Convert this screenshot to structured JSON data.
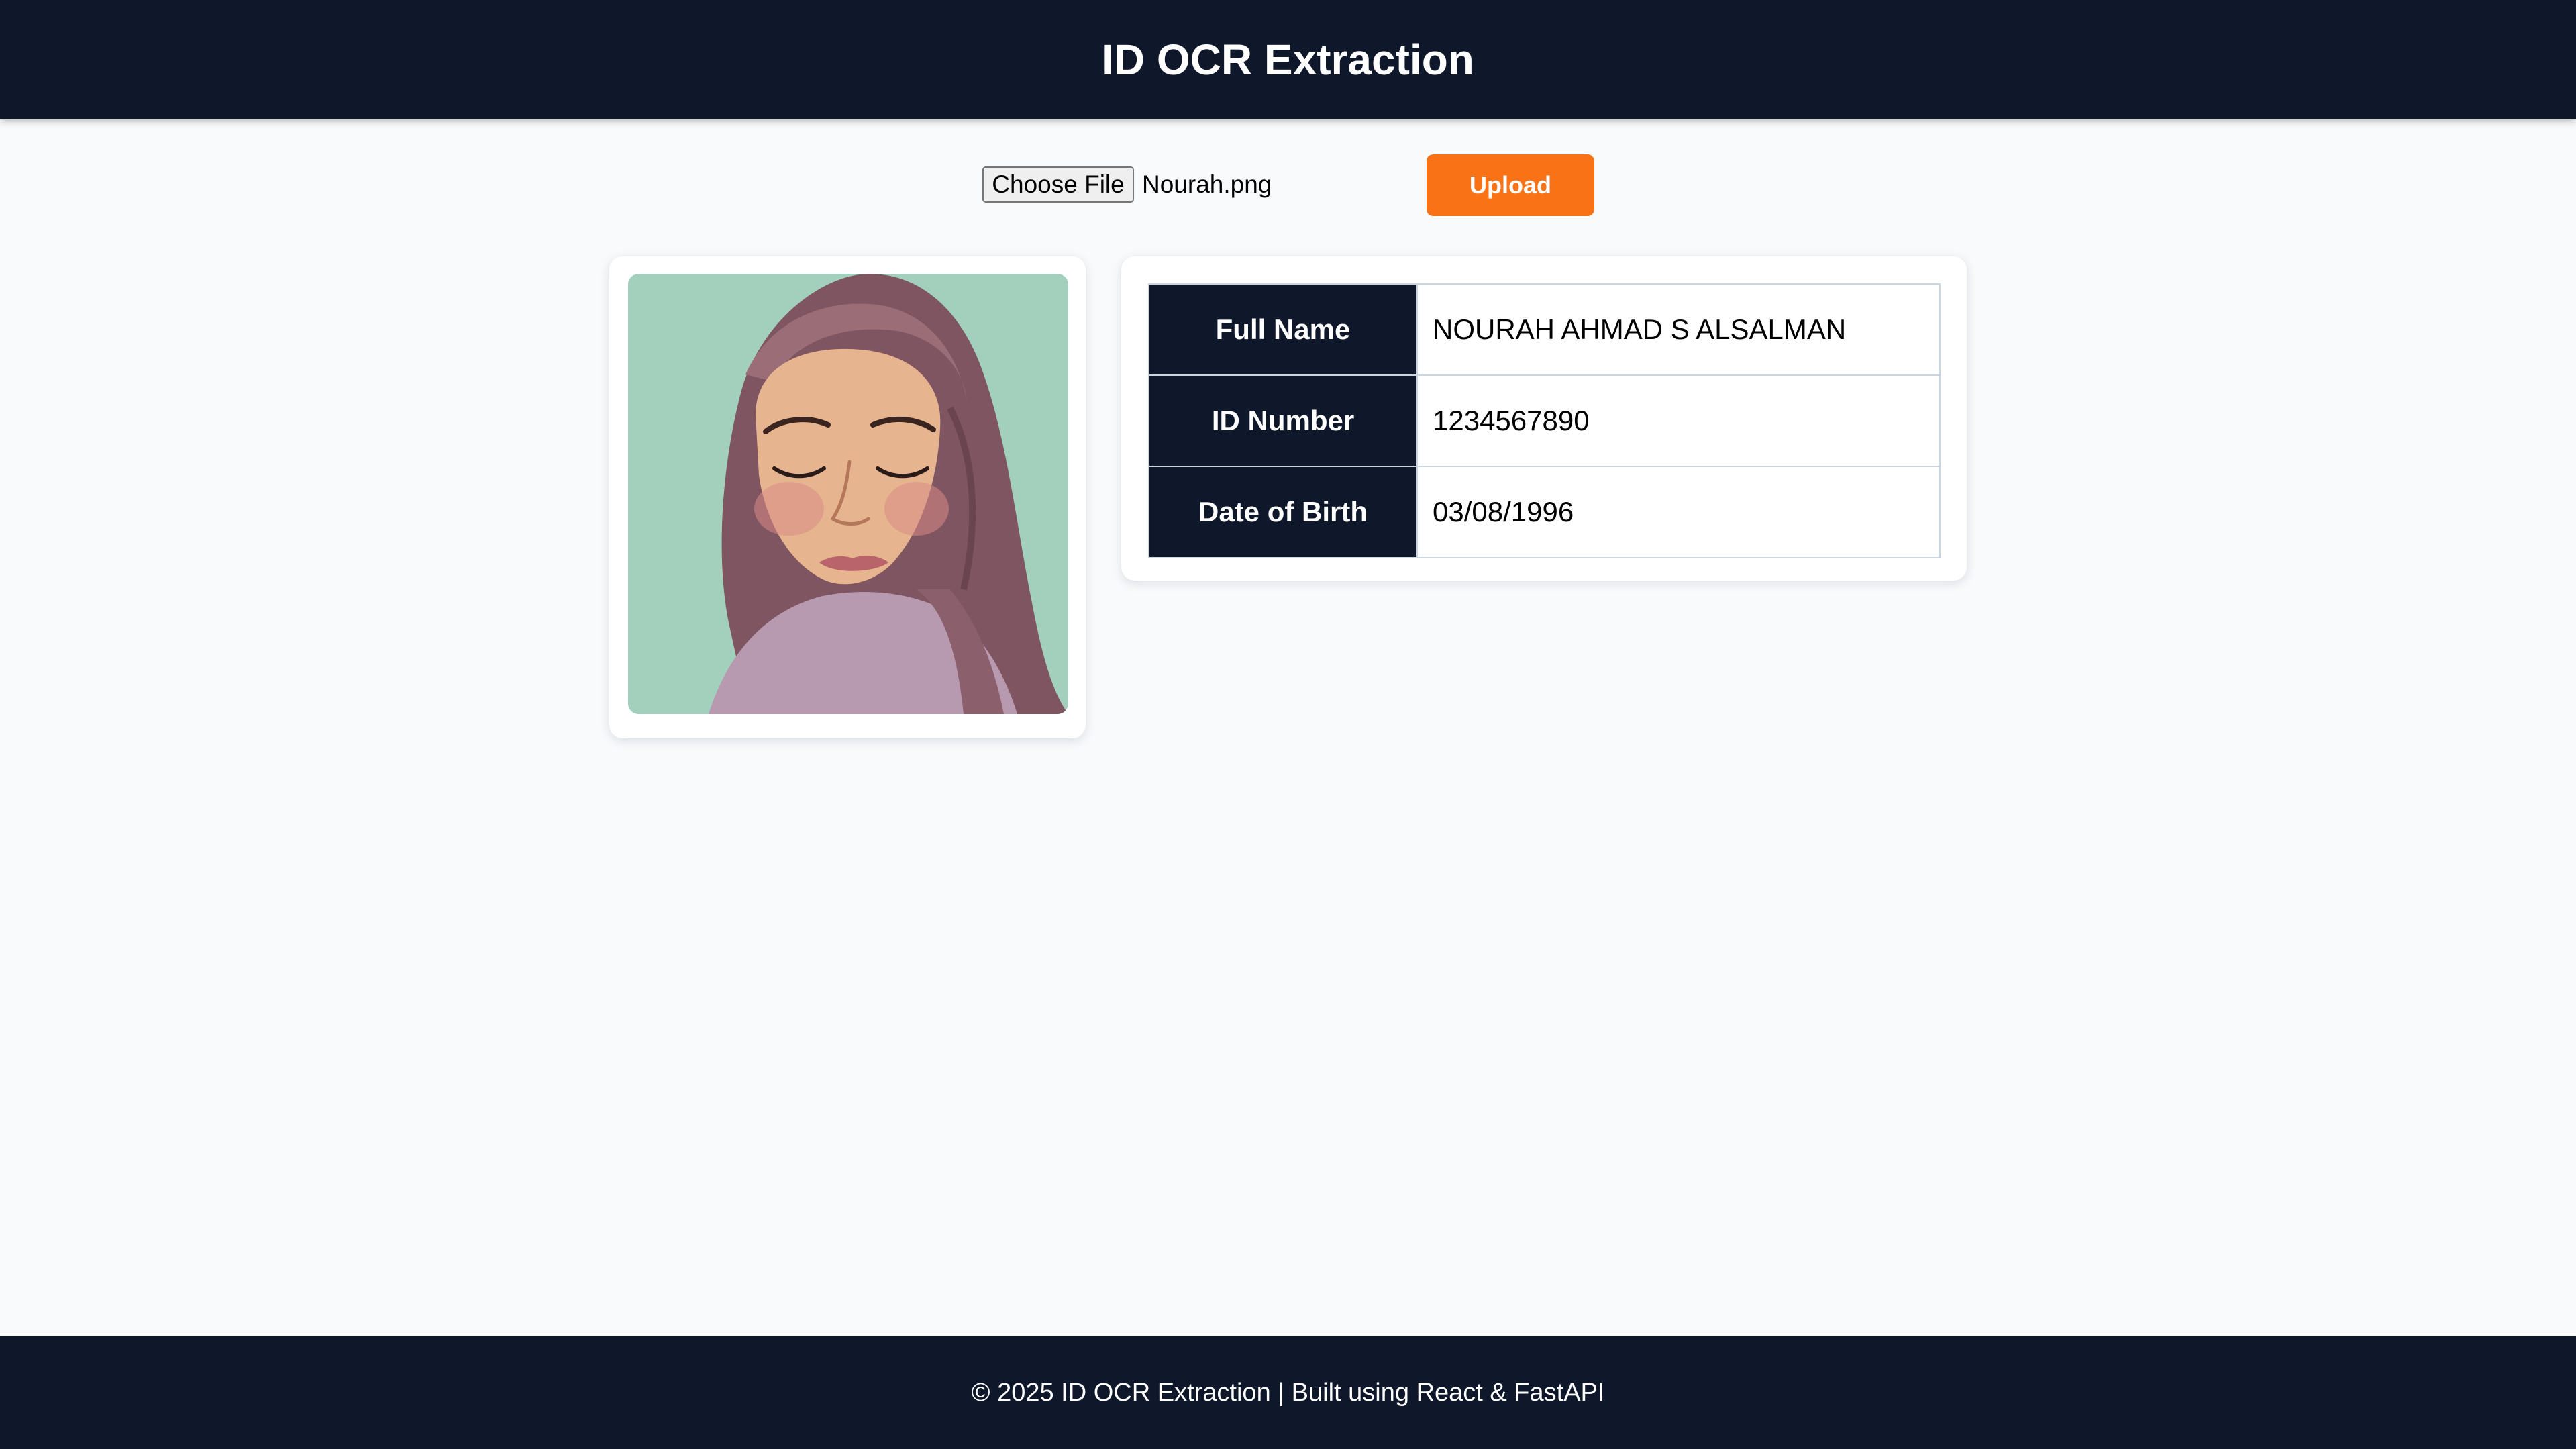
{
  "header": {
    "title": "ID OCR Extraction"
  },
  "upload": {
    "choose_file_label": "Choose File",
    "file_name": "Nourah.png",
    "upload_label": "Upload"
  },
  "photo": {
    "subject": "watercolor portrait of a woman in a mauve hijab",
    "background_color": "#a2d0bc"
  },
  "fields": {
    "full_name": {
      "label": "Full Name",
      "value": "NOURAH AHMAD S ALSALMAN"
    },
    "id_number": {
      "label": "ID Number",
      "value": "1234567890"
    },
    "dob": {
      "label": "Date of Birth",
      "value": "03/08/1996"
    }
  },
  "footer": {
    "text": "© 2025 ID OCR Extraction | Built using React & FastAPI"
  },
  "colors": {
    "navy": "#0f172a",
    "accent": "#f97316",
    "page_bg": "#f8fafc"
  }
}
